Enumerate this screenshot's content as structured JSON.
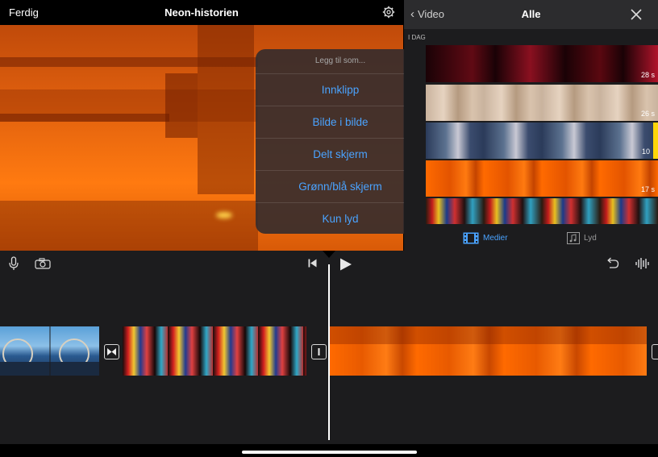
{
  "topbar": {
    "done_label": "Ferdig",
    "project_title": "Neon-historien",
    "settings_icon": "gear-icon"
  },
  "add_menu": {
    "title": "Legg til som...",
    "items": [
      {
        "label": "Innklipp"
      },
      {
        "label": "Bilde i bilde"
      },
      {
        "label": "Delt skjerm"
      },
      {
        "label": "Grønn/blå skjerm"
      },
      {
        "label": "Kun lyd"
      }
    ]
  },
  "browser": {
    "back_label": "Video",
    "title": "Alle",
    "section": "I DAG",
    "clips": [
      {
        "duration": "28 s",
        "theme": "red-laser"
      },
      {
        "duration": "26 s",
        "theme": "eyes"
      },
      {
        "duration": "10",
        "theme": "machine-laser",
        "selected": true
      },
      {
        "duration": "17 s",
        "theme": "orange-cutter"
      },
      {
        "duration": "",
        "theme": "neon-street"
      }
    ],
    "tabs": [
      {
        "label": "Medier",
        "icon": "film-icon",
        "active": true
      },
      {
        "label": "Lyd",
        "icon": "music-note-icon",
        "active": false
      }
    ]
  },
  "timeline": {
    "tools": {
      "mic_icon": "microphone-icon",
      "camera_icon": "camera-icon",
      "skip_back_icon": "skip-to-start-icon",
      "play_icon": "play-icon",
      "undo_icon": "undo-icon",
      "waveform_icon": "audio-waveform-icon"
    },
    "clips": [
      {
        "theme": "ferris-wheel"
      },
      {
        "theme": "neon-street"
      },
      {
        "theme": "orange-cutter"
      }
    ]
  },
  "colors": {
    "accent_blue": "#4aa3ff",
    "selected_yellow": "#ffd60a",
    "panel_bg": "#1c1c1e"
  }
}
